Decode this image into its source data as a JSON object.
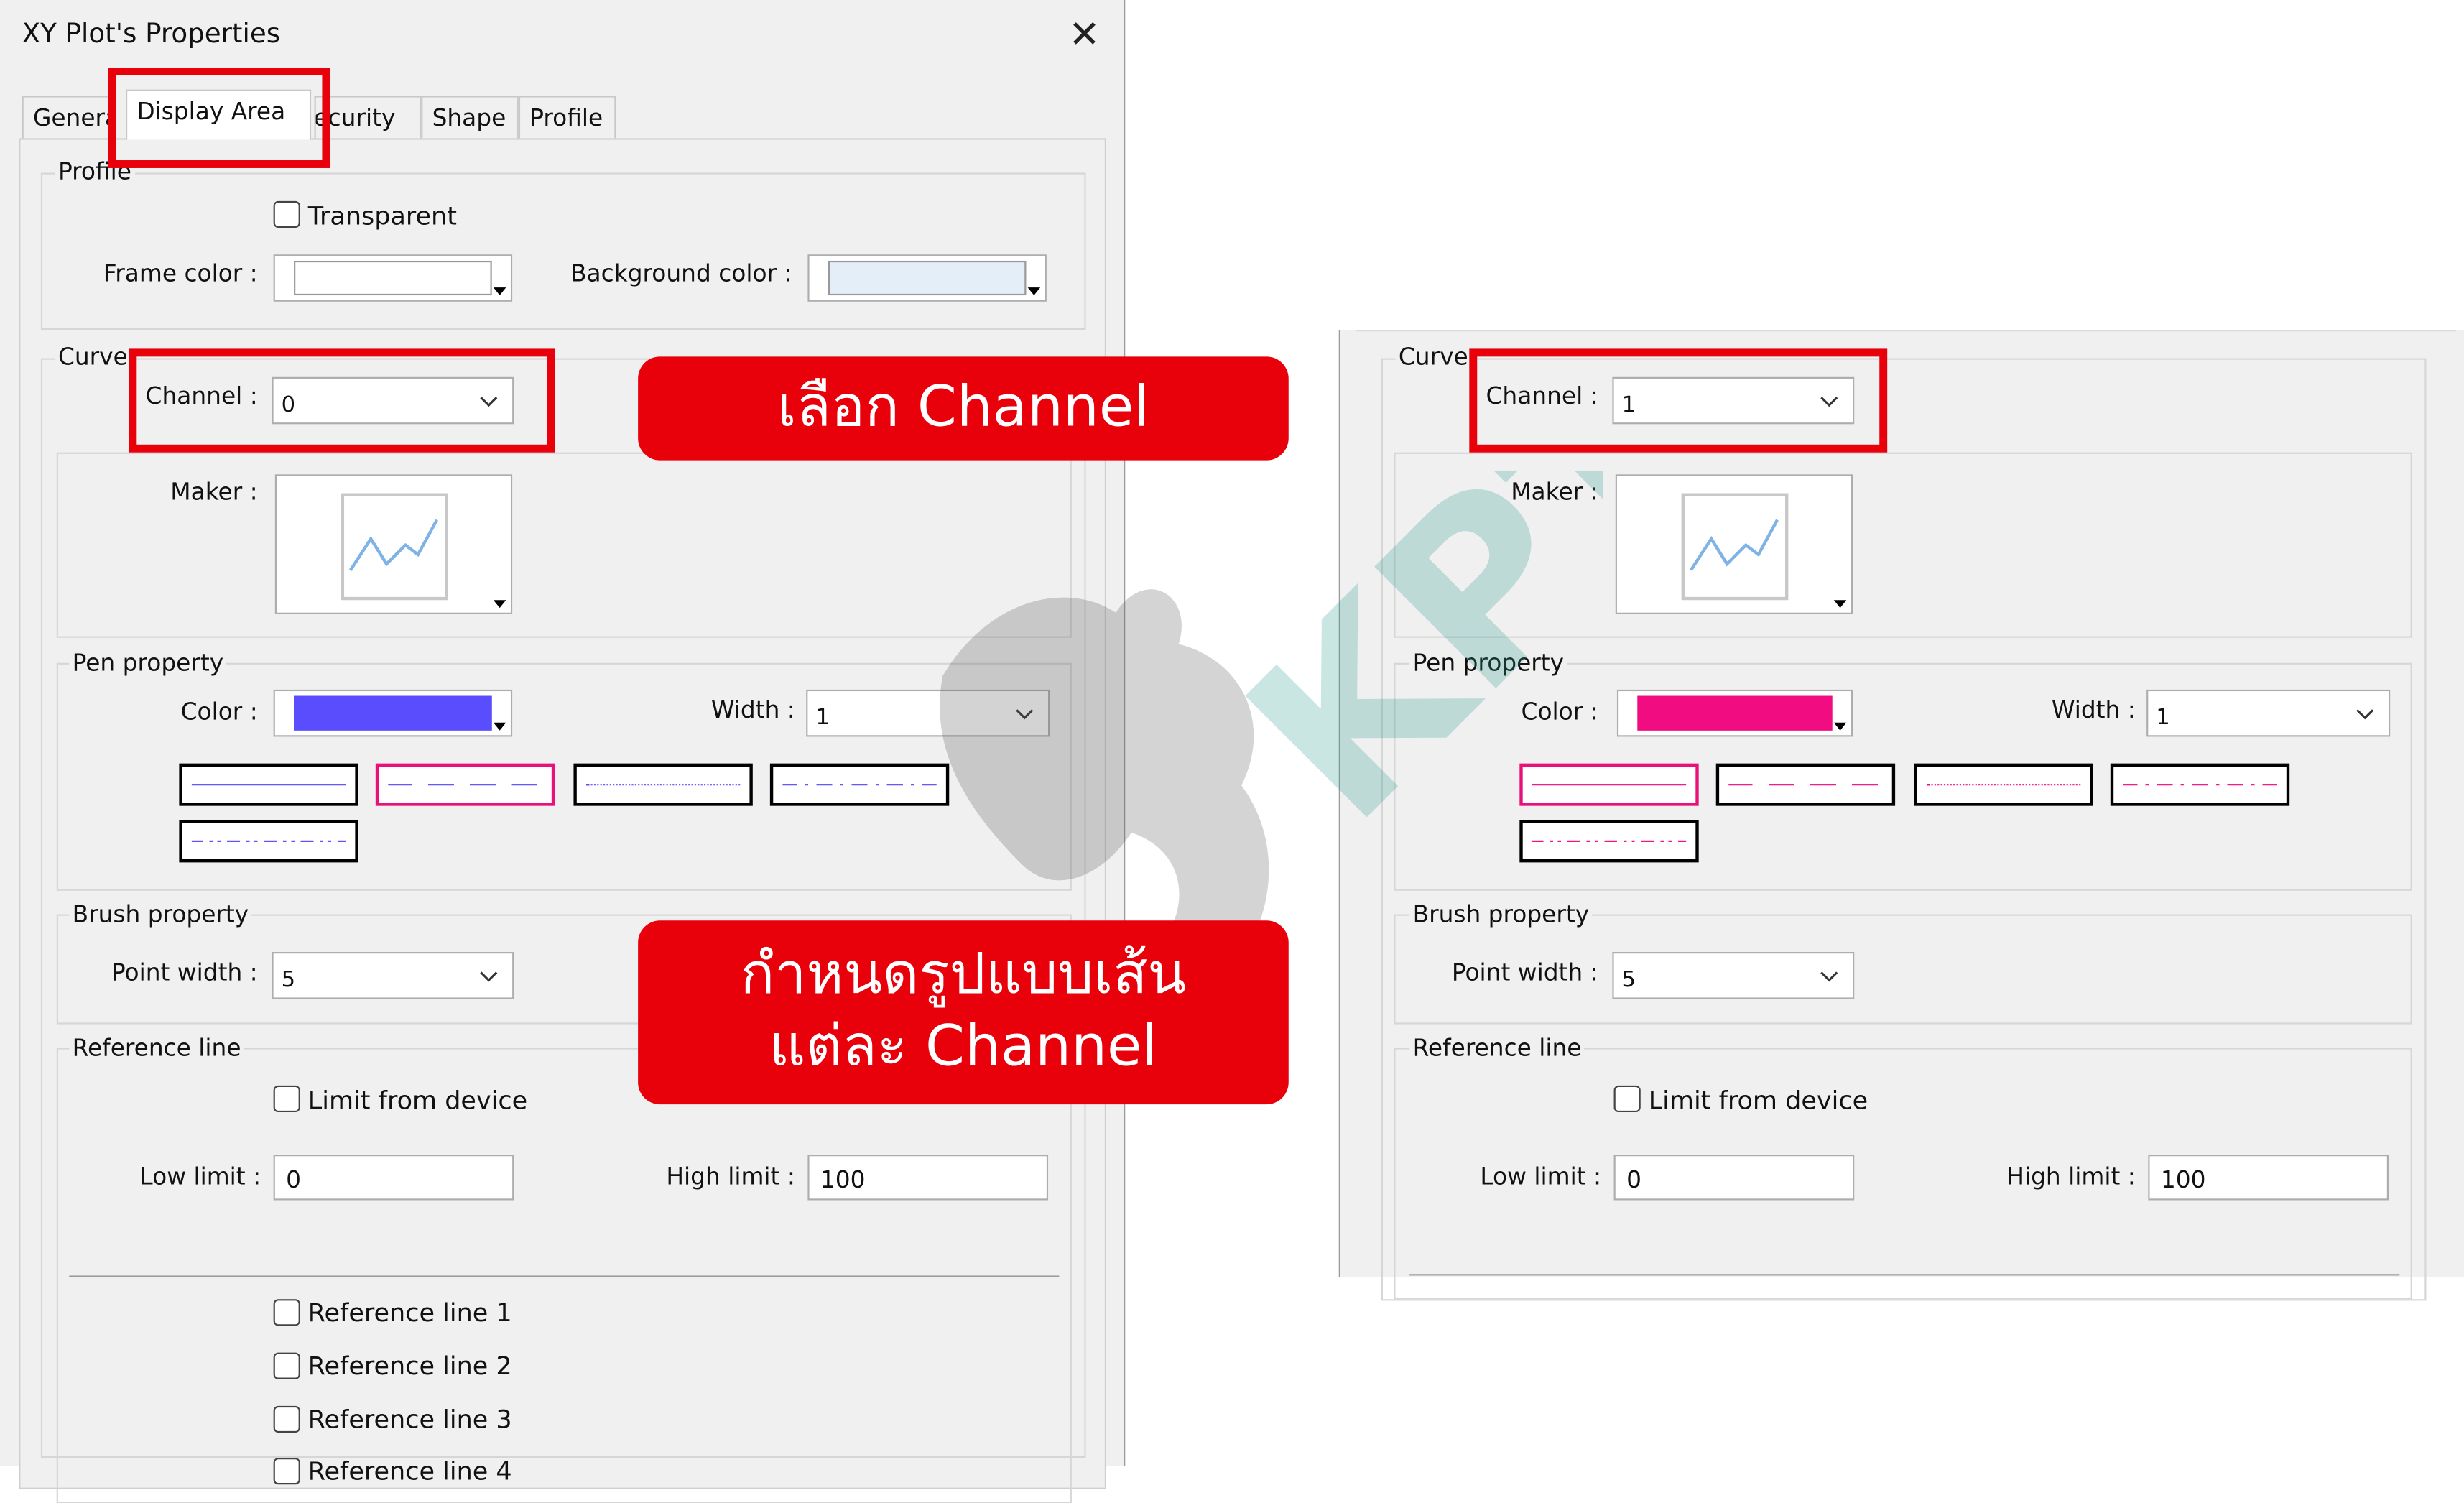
{
  "dialog": {
    "title": "XY Plot's Properties"
  },
  "tabs": [
    {
      "label": "General"
    },
    {
      "label": "Display Area"
    },
    {
      "label": "Security"
    },
    {
      "label": "Shape"
    },
    {
      "label": "Profile"
    }
  ],
  "profile": {
    "title": "Profile",
    "transparent_label": "Transparent",
    "frame_color_label": "Frame color :",
    "frame_color": "#ffffff",
    "background_color_label": "Background color :",
    "background_color": "#e4eef8"
  },
  "curve": {
    "title": "Curve",
    "channel_label": "Channel :",
    "channel_value_left": "0",
    "channel_value_right": "1",
    "maker_label": "Maker :"
  },
  "pen": {
    "title": "Pen property",
    "color_label": "Color :",
    "color_left": "#5a4dfd",
    "color_right": "#f20c82",
    "width_label": "Width :",
    "width_value": "1"
  },
  "brush": {
    "title": "Brush property",
    "point_width_label": "Point width :",
    "point_width_value": "5"
  },
  "reference": {
    "title": "Reference line",
    "limit_label": "Limit from device",
    "low_label": "Low limit :",
    "low_value": "0",
    "high_label": "High limit :",
    "high_value": "100",
    "lines": [
      "Reference line 1",
      "Reference line 2",
      "Reference line 3",
      "Reference line 4"
    ]
  },
  "annotations": {
    "select_channel": "เลือก Channel",
    "line_style_1": "กำหนดรูปแบบเส้น",
    "line_style_2": "แต่ละ Channel"
  },
  "watermark": {
    "text": "KPT"
  }
}
